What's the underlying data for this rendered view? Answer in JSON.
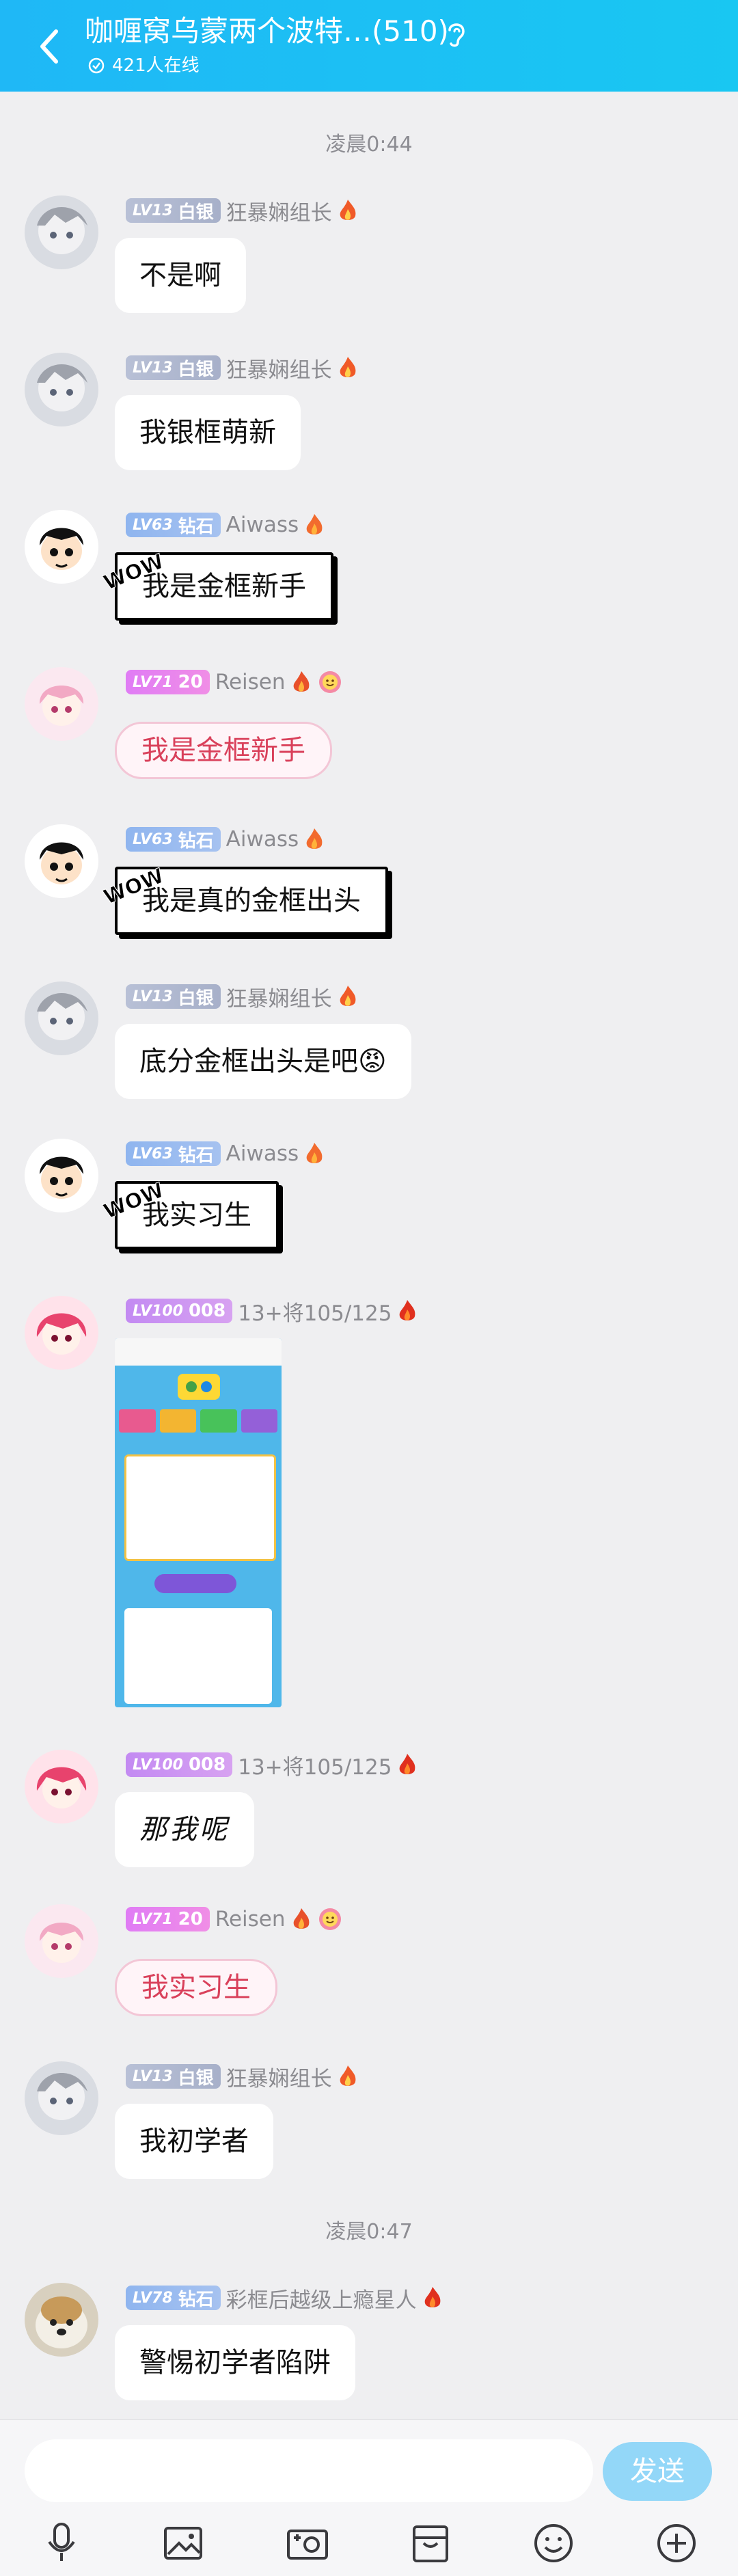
{
  "header": {
    "title": "咖喱窝乌蒙两个波特…(510)",
    "online": "421人在线"
  },
  "timestamps": [
    "凌晨0:44",
    "凌晨0:47"
  ],
  "messages": [
    {
      "level": "LV13",
      "rank": "白银",
      "name": "狂暴娴组长",
      "text": "不是啊"
    },
    {
      "level": "LV13",
      "rank": "白银",
      "name": "狂暴娴组长",
      "text": "我银框萌新"
    },
    {
      "level": "LV63",
      "rank": "钻石",
      "name": "Aiwass",
      "text": "我是金框新手"
    },
    {
      "level": "LV71",
      "rank": "20",
      "name": "Reisen",
      "text": "我是金框新手"
    },
    {
      "level": "LV63",
      "rank": "钻石",
      "name": "Aiwass",
      "text": "我是真的金框出头"
    },
    {
      "level": "LV13",
      "rank": "白银",
      "name": "狂暴娴组长",
      "text": "底分金框出头是吧😡"
    },
    {
      "level": "LV63",
      "rank": "钻石",
      "name": "Aiwass",
      "text": "我实习生"
    },
    {
      "level": "LV100",
      "rank": "008",
      "name": "13+将105/125",
      "text": ""
    },
    {
      "level": "LV100",
      "rank": "008",
      "name": "13+将105/125",
      "text": "那我呢"
    },
    {
      "level": "LV71",
      "rank": "20",
      "name": "Reisen",
      "text": "我实习生"
    },
    {
      "level": "LV13",
      "rank": "白银",
      "name": "狂暴娴组长",
      "text": "我初学者"
    },
    {
      "level": "LV78",
      "rank": "钻石",
      "name": "彩框后越级上瘾星人",
      "text": "警惕初学者陷阱"
    }
  ],
  "comic_tag": "WOW",
  "composer": {
    "send_label": "发送"
  },
  "icons": {
    "back": "back-arrow-icon",
    "ear": "ear-icon",
    "online": "check-circle-icon",
    "voice": "microphone-icon",
    "image": "image-icon",
    "camera": "camera-icon",
    "bag": "bag-icon",
    "emoji": "smile-icon",
    "plus": "plus-icon"
  },
  "colors": {
    "header": "#1fb8f6",
    "send": "#93d7f8",
    "background": "#efeff1"
  }
}
